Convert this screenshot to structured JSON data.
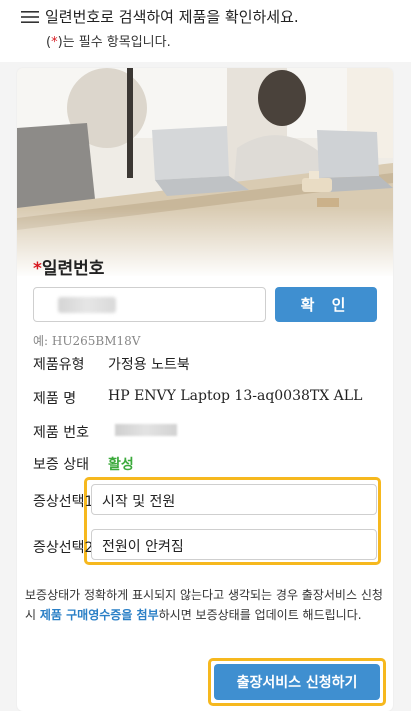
{
  "header": {
    "search_instruction": "일련번호로 검색하여 제품을 확인하세요.",
    "required_prefix": "(",
    "required_mark": "*",
    "required_suffix": ")는 필수 항목입니다."
  },
  "serial": {
    "required_mark": "*",
    "title": "일련번호",
    "input_value": "",
    "confirm_label": "확 인",
    "example": "예: HU265BM18V"
  },
  "product": {
    "type_label": "제품유형",
    "type_value": "가정용 노트북",
    "name_label": "제품 명",
    "name_value": "HP ENVY Laptop 13-aq0038TX ALL",
    "number_label": "제품 번호",
    "number_value": "",
    "warranty_label": "보증 상태",
    "warranty_value": "활성"
  },
  "symptoms": {
    "label1": "증상선택1",
    "value1": "시작 및 전원",
    "label2": "증상선택2",
    "value2": "전원이 안켜짐",
    "required_mark": "*"
  },
  "notice": {
    "text_before": "보증상태가 정확하게 표시되지 않는다고 생각되는 경우 출장서비스 신청 시 ",
    "link": "제품 구매영수증을 첨부",
    "text_after": "하시면 보증상태를 업데이트 해드립니다."
  },
  "submit_label": "출장서비스 신청하기",
  "colors": {
    "accent_blue": "#3f8fd0",
    "required_red": "#d71920",
    "highlight_yellow": "#f6b81e",
    "active_green": "#3caa3c",
    "link_blue": "#2a7fc6"
  }
}
